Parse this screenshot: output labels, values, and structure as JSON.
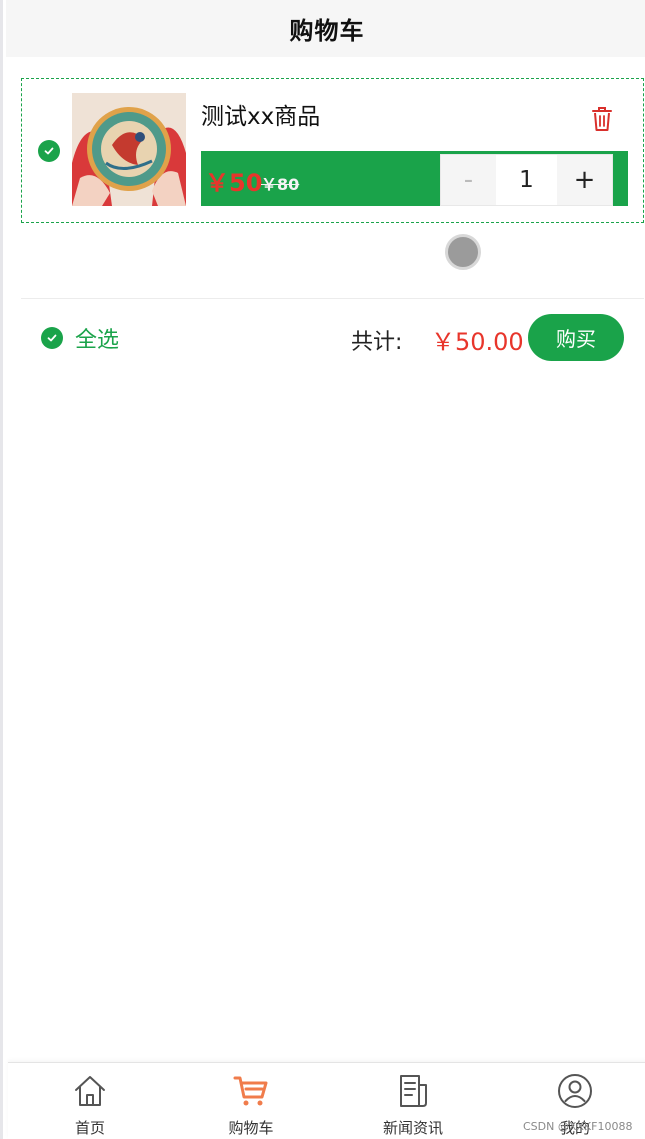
{
  "header": {
    "title": "购物车"
  },
  "cart": {
    "item": {
      "name": "测试xx商品",
      "price": "￥50",
      "original_price": "￥80",
      "quantity": "1",
      "minus": "-",
      "plus": "+",
      "selected": true
    }
  },
  "footer": {
    "select_all": "全选",
    "total_label": "共计:",
    "total_amount": "￥50.00",
    "buy": "购买"
  },
  "tabbar": {
    "items": [
      {
        "label": "首页",
        "icon": "home-icon"
      },
      {
        "label": "购物车",
        "icon": "cart-icon",
        "active": true
      },
      {
        "label": "新闻资讯",
        "icon": "news-icon"
      },
      {
        "label": "我的",
        "icon": "user-icon"
      }
    ]
  },
  "watermark": "CSDN @XXKF10088",
  "colors": {
    "primary_green": "#1aa34a",
    "price_red": "#e8352b",
    "active_tab": "#f07c4b"
  }
}
